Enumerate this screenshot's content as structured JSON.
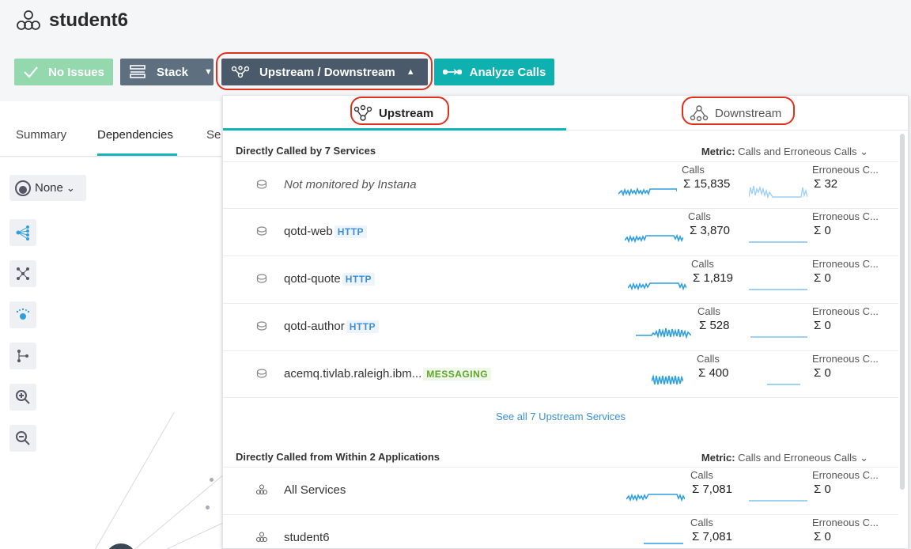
{
  "app": {
    "title": "student6"
  },
  "toolbar": {
    "no_issues": "No Issues",
    "stack": "Stack",
    "updown": "Upstream / Downstream",
    "analyze": "Analyze Calls"
  },
  "tabs": [
    "Summary",
    "Dependencies",
    "Se"
  ],
  "canvas": {
    "none_label": "None"
  },
  "panel": {
    "tab_up": "Upstream",
    "tab_down": "Downstream",
    "section1": {
      "title": "Directly Called by 7 Services",
      "metric_label": "Metric:",
      "metric_value": "Calls and Erroneous Calls"
    },
    "rows": [
      {
        "name": "Not monitored by Instana",
        "badge": "",
        "calls_label": "Calls",
        "calls": "Σ 15,835",
        "err_label": "Erroneous C...",
        "err": "Σ 32"
      },
      {
        "name": "qotd-web",
        "badge": "HTTP",
        "calls_label": "Calls",
        "calls": "Σ 3,870",
        "err_label": "Erroneous C...",
        "err": "Σ 0"
      },
      {
        "name": "qotd-quote",
        "badge": "HTTP",
        "calls_label": "Calls",
        "calls": "Σ 1,819",
        "err_label": "Erroneous C...",
        "err": "Σ 0"
      },
      {
        "name": "qotd-author",
        "badge": "HTTP",
        "calls_label": "Calls",
        "calls": "Σ 528",
        "err_label": "Erroneous C...",
        "err": "Σ 0"
      },
      {
        "name": "acemq.tivlab.raleigh.ibm...",
        "badge": "MESSAGING",
        "calls_label": "Calls",
        "calls": "Σ 400",
        "err_label": "Erroneous C...",
        "err": "Σ 0"
      }
    ],
    "see_all": "See all 7 Upstream Services",
    "section2": {
      "title": "Directly Called from Within 2 Applications",
      "metric_label": "Metric:",
      "metric_value": "Calls and Erroneous Calls"
    },
    "app_rows": [
      {
        "name": "All Services",
        "calls_label": "Calls",
        "calls": "Σ 7,081",
        "err_label": "Erroneous C...",
        "err": "Σ 0"
      },
      {
        "name": "student6",
        "calls_label": "Calls",
        "calls": "Σ 7,081",
        "err_label": "Erroneous C...",
        "err": "Σ 0"
      }
    ]
  },
  "colors": {
    "accent": "#12b5b5",
    "spark": "#2f9fe0",
    "link": "#3b8fd6"
  }
}
